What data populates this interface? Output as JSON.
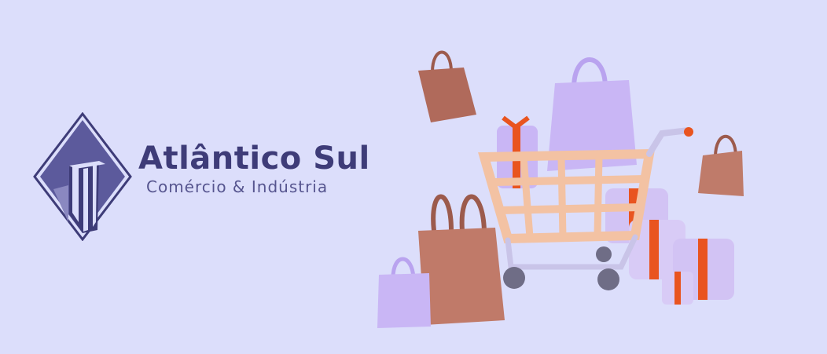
{
  "brand": {
    "name": "Atlântico Sul",
    "tagline": "Comércio & Indústria"
  },
  "colors": {
    "background": "#dcdefb",
    "logo": "#3e3c78",
    "bag_brown": "#b86f5e",
    "bag_lilac": "#c9b6f5",
    "ribbon": "#e9541f",
    "cart": "#f3c2a3"
  }
}
